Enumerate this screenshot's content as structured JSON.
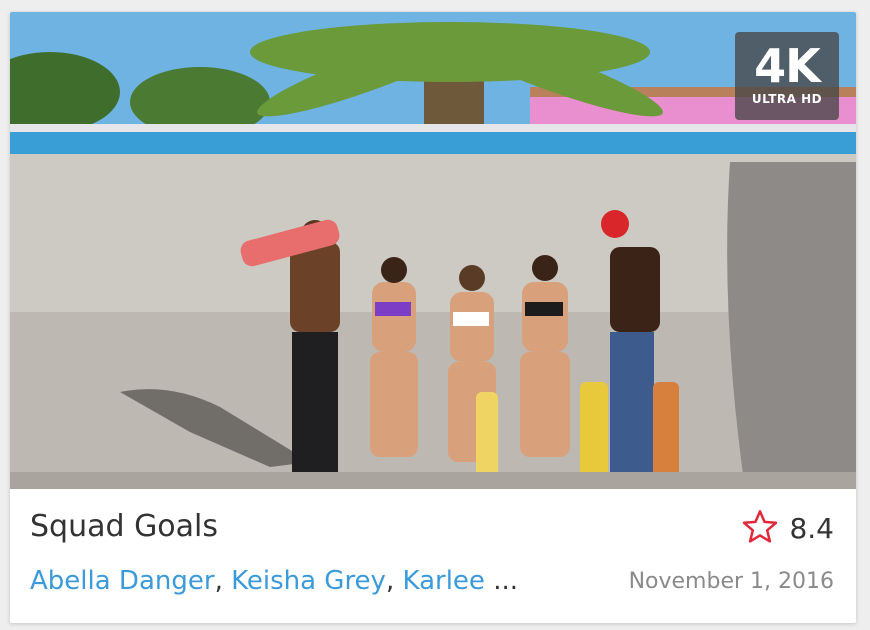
{
  "video": {
    "title": "Squad Goals",
    "rating": "8.4",
    "date": "November 1, 2016",
    "badge": {
      "main": "4K",
      "sub": "ULTRA HD"
    },
    "performers": [
      "Abella Danger",
      "Keisha Grey",
      "Karlee"
    ],
    "separator": ",",
    "overflow": "...",
    "icons": {
      "rating": "star-outline-icon"
    },
    "colors": {
      "link": "#3b9ad9",
      "star": "#e0283a"
    }
  }
}
